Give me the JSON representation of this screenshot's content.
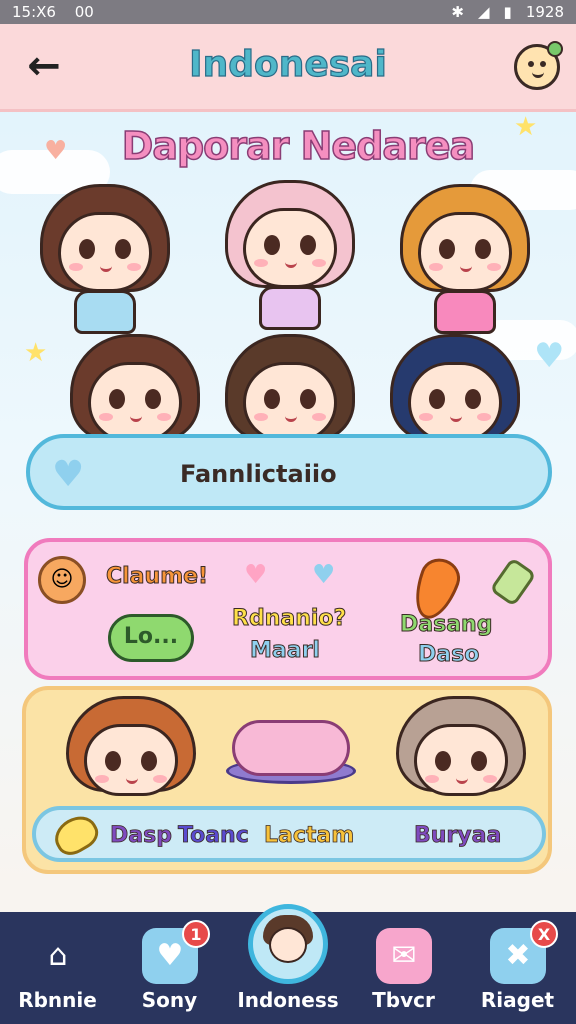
{
  "status_bar": {
    "time": "15:X6",
    "extra": "00",
    "clock": "1928"
  },
  "header": {
    "title": "Indonesai",
    "back_icon": "back-arrow-icon",
    "avatar_icon": "mascot-face-icon"
  },
  "banner": {
    "title": "Daporar Nedarea"
  },
  "characters": [
    {
      "hair": "#6b3b2c",
      "outfit": "#a8dcf2"
    },
    {
      "hair": "#f4c3cf",
      "outfit": "#e8c4f0"
    },
    {
      "hair": "#e59a3a",
      "outfit": "#f889bd"
    },
    {
      "hair": "#6b3b2c",
      "outfit": "#ffe04a"
    },
    {
      "hair": "#5a3a2a",
      "outfit": "#76c26c"
    },
    {
      "hair": "#263a6e",
      "outfit": "#f57cae"
    }
  ],
  "fan_bar": {
    "label": "Fannlictaiio"
  },
  "pink_panel": {
    "claim_label": "Claume!",
    "bubble_label": "Lo...",
    "mid_line1": "Rdnanio?",
    "mid_line2": "Maarl",
    "right_line1": "Dasang",
    "right_line2": "Daso"
  },
  "yellow_panel": {
    "bar_label_1": "Dasp",
    "bar_label_2": "Toanc",
    "bar_label_3": "Lactam",
    "bar_label_4": "Buryaa"
  },
  "nav": [
    {
      "label": "Rbnnie",
      "icon": "home-icon",
      "badge": ""
    },
    {
      "label": "Sony",
      "icon": "heart-chat-icon",
      "badge": "1"
    },
    {
      "label": "Indoness",
      "icon": "avatar-icon",
      "badge": ""
    },
    {
      "label": "Tbvcr",
      "icon": "mail-icon",
      "badge": ""
    },
    {
      "label": "Riaget",
      "icon": "puzzle-icon",
      "badge": "X"
    }
  ]
}
